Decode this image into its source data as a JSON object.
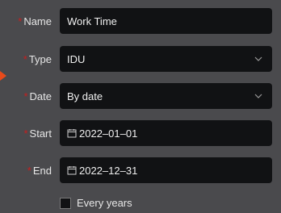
{
  "form": {
    "name": {
      "label": "Name",
      "value": "Work Time"
    },
    "type": {
      "label": "Type",
      "value": "IDU"
    },
    "date": {
      "label": "Date",
      "value": "By date"
    },
    "start": {
      "label": "Start",
      "value": "2022–01–01"
    },
    "end": {
      "label": "End",
      "value": "2022–12–31"
    },
    "every_years": {
      "label": "Every years",
      "checked": false
    }
  },
  "colors": {
    "background": "#4a4a4d",
    "field": "#111214",
    "required": "#c81e1e",
    "pointer": "#e84a1a"
  },
  "icons": {
    "select": "chevron-down-icon",
    "date": "calendar-icon"
  }
}
